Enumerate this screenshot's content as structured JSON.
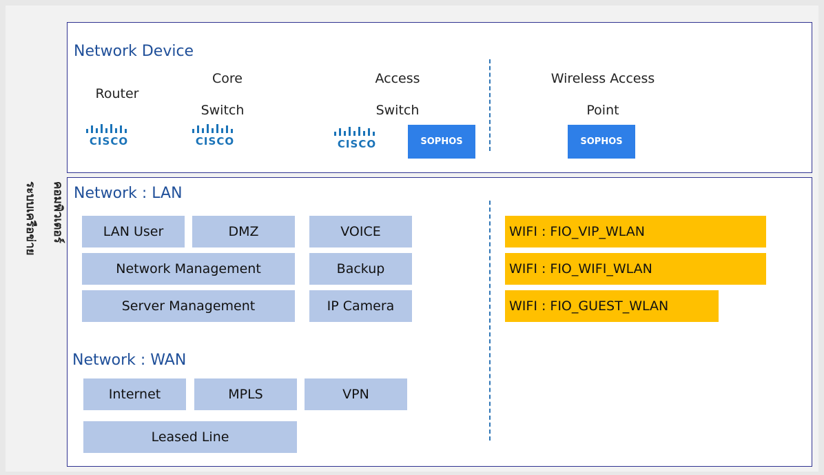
{
  "side_label": {
    "line1": "ระบบเครือข่าย",
    "line2": "คอมพิวเตอร์"
  },
  "device_panel": {
    "heading": "Network Device",
    "router": {
      "label": "Router",
      "logo": "CISCO"
    },
    "core_switch": {
      "label_line1": "Core",
      "label_line2": "Switch",
      "logo": "CISCO"
    },
    "access_switch": {
      "label_line1": "Access",
      "label_line2": "Switch",
      "logo": "CISCO",
      "logo2": "SOPHOS"
    },
    "wireless_ap": {
      "label_line1": "Wireless Access",
      "label_line2": "Point",
      "logo": "SOPHOS"
    }
  },
  "network_panel": {
    "lan_heading": "Network : LAN",
    "lan_items": {
      "lan_user": "LAN User",
      "dmz": "DMZ",
      "voice": "VOICE",
      "network_management": "Network Management",
      "backup": "Backup",
      "server_management": "Server Management",
      "ip_camera": "IP Camera"
    },
    "wan_heading": "Network : WAN",
    "wan_items": {
      "internet": "Internet",
      "mpls": "MPLS",
      "vpn": "VPN",
      "leased_line": "Leased Line"
    },
    "wifi_items": [
      "WIFI : FIO_VIP_WLAN",
      "WIFI : FIO_WIFI_WLAN",
      "WIFI : FIO_GUEST_WLAN"
    ]
  },
  "colors": {
    "border": "#2f3190",
    "heading": "#1f4f99",
    "lan_box": "#b4c7e7",
    "wifi_box": "#ffc000",
    "cisco": "#1a73b8",
    "sophos": "#2e7fe8"
  }
}
